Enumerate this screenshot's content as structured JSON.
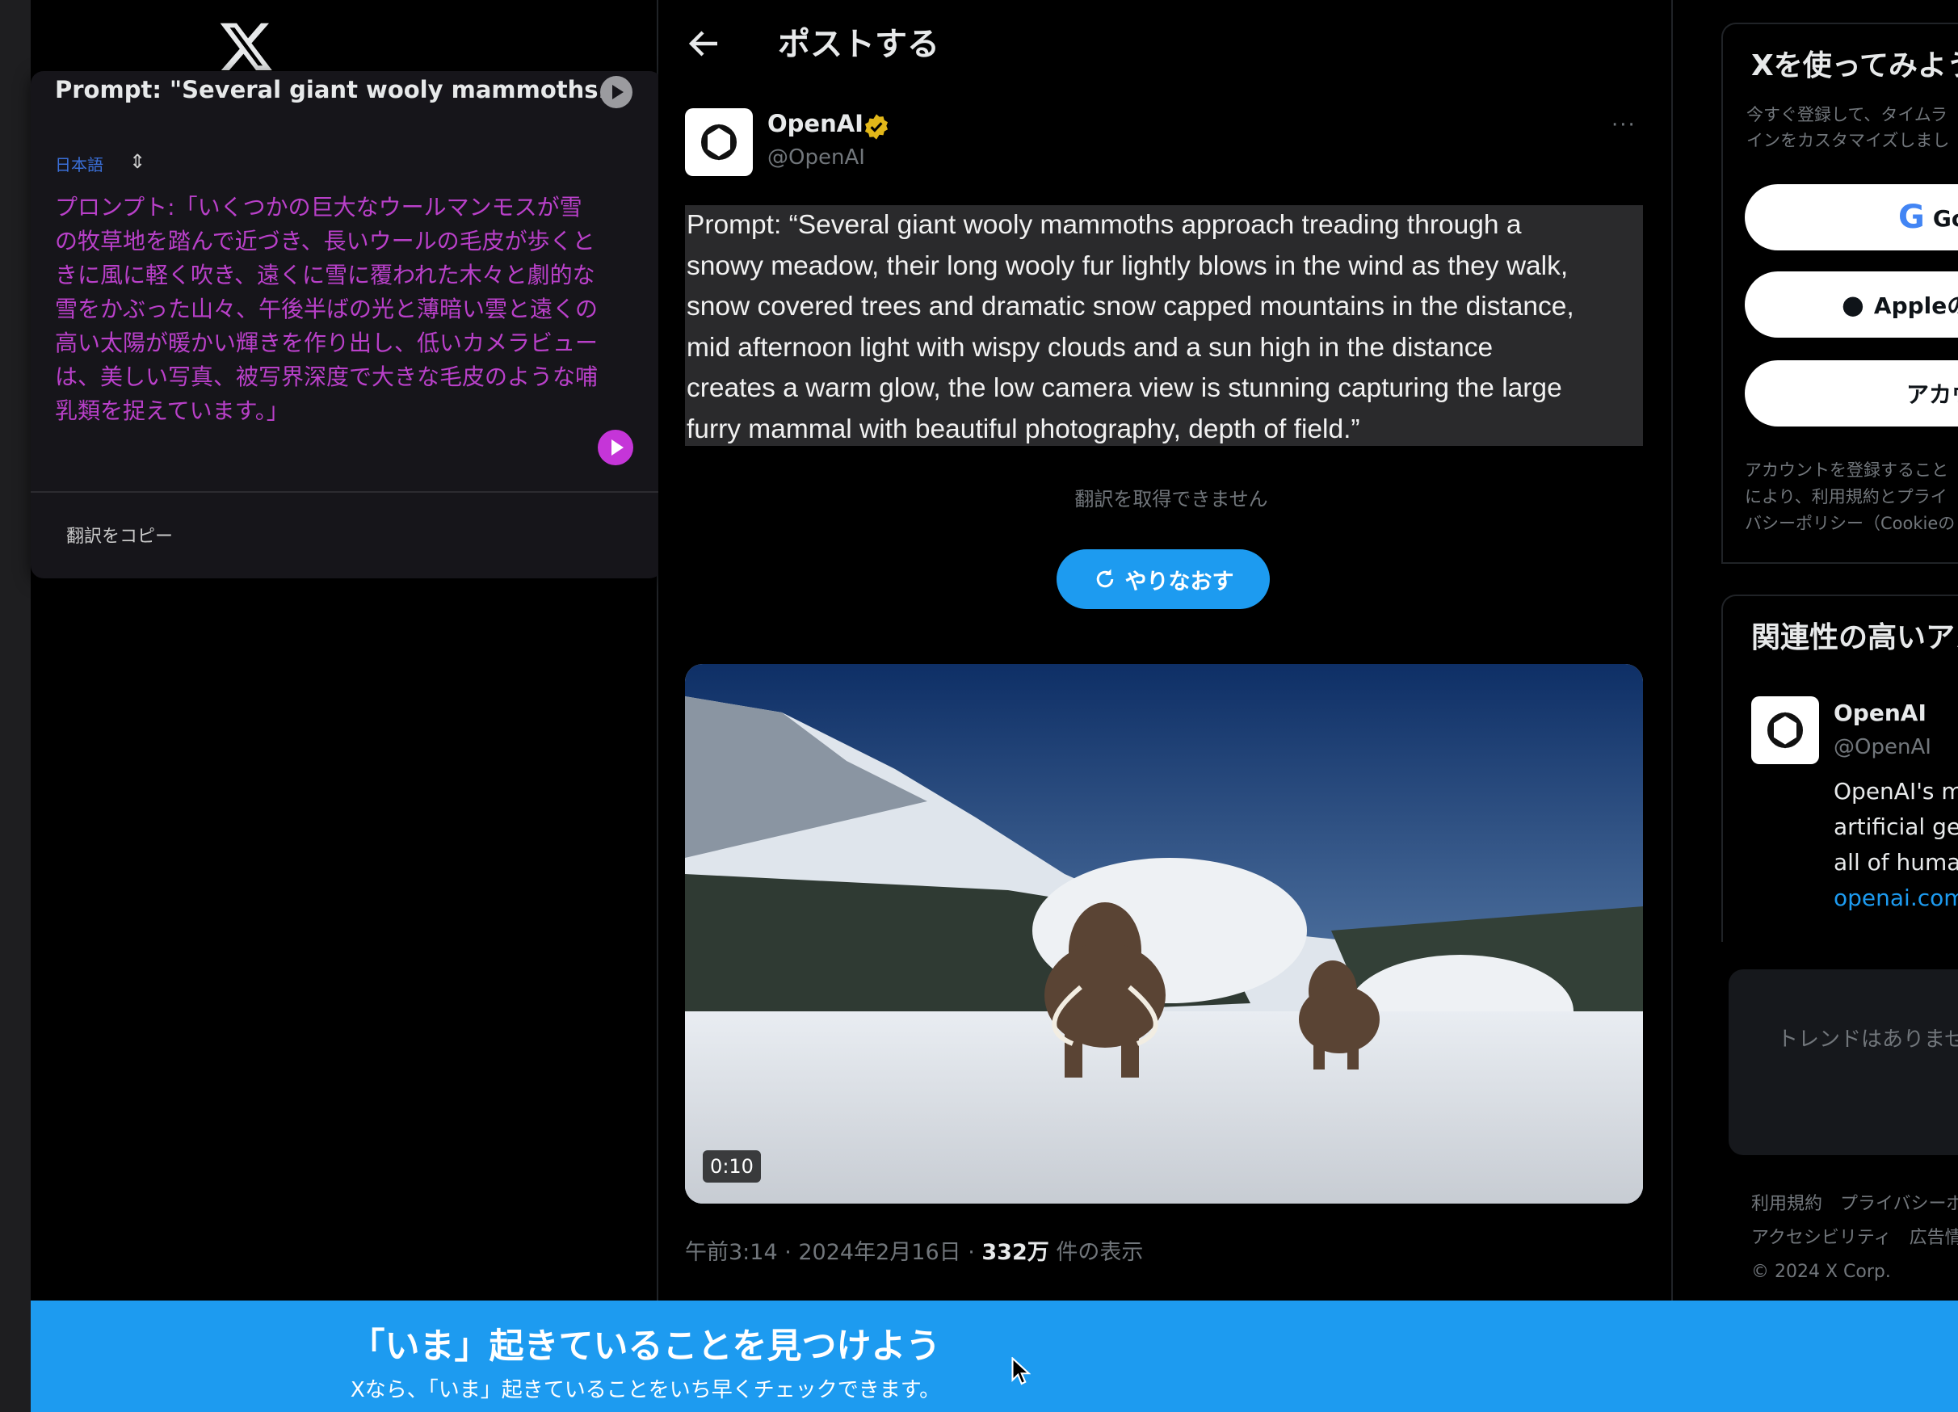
{
  "popup": {
    "title": "Prompt: \"Several giant wooly mammoths...",
    "language": "日本語",
    "translation": "プロンプト:「いくつかの巨大なウールマンモスが雪の牧草地を踏んで近づき、長いウールの毛皮が歩くときに風に軽く吹き、遠くに雪に覆われた木々と劇的な雪をかぶった山々、午後半ばの光と薄暗い雲と遠くの高い太陽が暖かい輝きを作り出し、低いカメラビューは、美しい写真、被写界深度で大きな毛皮のような哺乳類を捉えています。」",
    "copy_label": "翻訳をコピー"
  },
  "header": {
    "title": "ポストする"
  },
  "post": {
    "author_name": "OpenAI",
    "author_handle": "@OpenAI",
    "text": "Prompt: “Several giant wooly mammoths approach treading through a\nsnowy meadow, their long wooly fur lightly blows in the wind as they walk,\nsnow covered trees and dramatic snow capped mountains in the distance,\nmid afternoon light with wispy clouds and a sun high in the distance\ncreates a warm glow, the low camera view is stunning capturing the large\nfurry mammal with beautiful photography, depth of field.”",
    "translation_error": "翻訳を取得できません",
    "retry_label": "やりなおす",
    "video_duration": "0:10",
    "meta_time": "午前3:14 · 2024年2月16日 · ",
    "meta_views": "332万",
    "meta_views_suffix": " 件の表示"
  },
  "sidebar": {
    "try_title": "Xを使ってみよう",
    "try_sub": "今すぐ登録して、タイムラインをカスタマイズしましょう。",
    "google_label": "Googleで登録",
    "apple_label": "Appleのアカウントで登録",
    "account_label": "アカウントを作成",
    "legal_text": "アカウントを登録することにより、利用規約とプライバシーポリシー（Cookieの使用を含む）に同意したとみなされます。",
    "legal_link": "ーポリシー（Cookieの",
    "relevant_title": "関連性の高いアカウント",
    "rel_name": "OpenAI",
    "rel_handle": "@OpenAI",
    "rel_bio_1": "OpenAI's mission is to ensure that",
    "rel_bio_2": "artificial general intelligence benefits",
    "rel_bio_3": "all of humanity.",
    "rel_bio_link": "openai.com",
    "trends_text": "トレンドはありません",
    "footer_1": "利用規約　プライバシーポリシー",
    "footer_2": "アクセシビリティ　広告情報",
    "footer_3": "© 2024 X Corp."
  },
  "banner": {
    "title": "「いま」起きていることを見つけよう",
    "subtitle": "Xなら、「いま」起きていることをいち早くチェックできます。"
  },
  "colors": {
    "accent": "#1d9bf0",
    "pink": "#c535d8",
    "background": "#000000"
  }
}
